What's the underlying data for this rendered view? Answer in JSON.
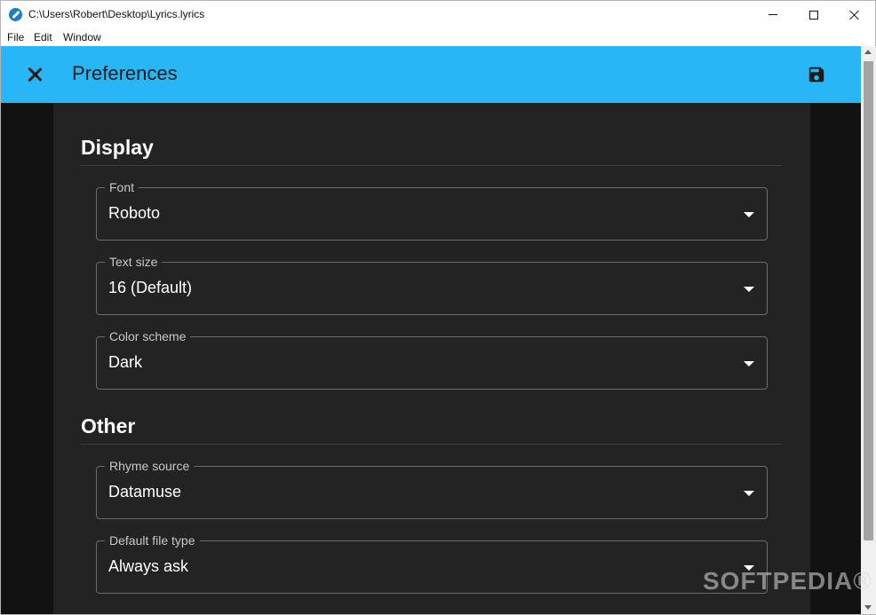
{
  "window": {
    "title": "C:\\Users\\Robert\\Desktop\\Lyrics.lyrics"
  },
  "menu": {
    "items": [
      {
        "label": "File"
      },
      {
        "label": "Edit"
      },
      {
        "label": "Window"
      }
    ]
  },
  "appbar": {
    "title": "Preferences",
    "close_icon": "close-icon",
    "save_icon": "save-icon"
  },
  "sections": {
    "display": {
      "title": "Display",
      "fields": [
        {
          "label": "Font",
          "value": "Roboto"
        },
        {
          "label": "Text size",
          "value": "16 (Default)"
        },
        {
          "label": "Color scheme",
          "value": "Dark"
        }
      ]
    },
    "other": {
      "title": "Other",
      "fields": [
        {
          "label": "Rhyme source",
          "value": "Datamuse"
        },
        {
          "label": "Default file type",
          "value": "Always ask"
        }
      ]
    }
  },
  "watermark": "SOFTPEDIA®",
  "colors": {
    "appbar": "#29b6f6",
    "background": "#121212",
    "panel": "#232323"
  }
}
